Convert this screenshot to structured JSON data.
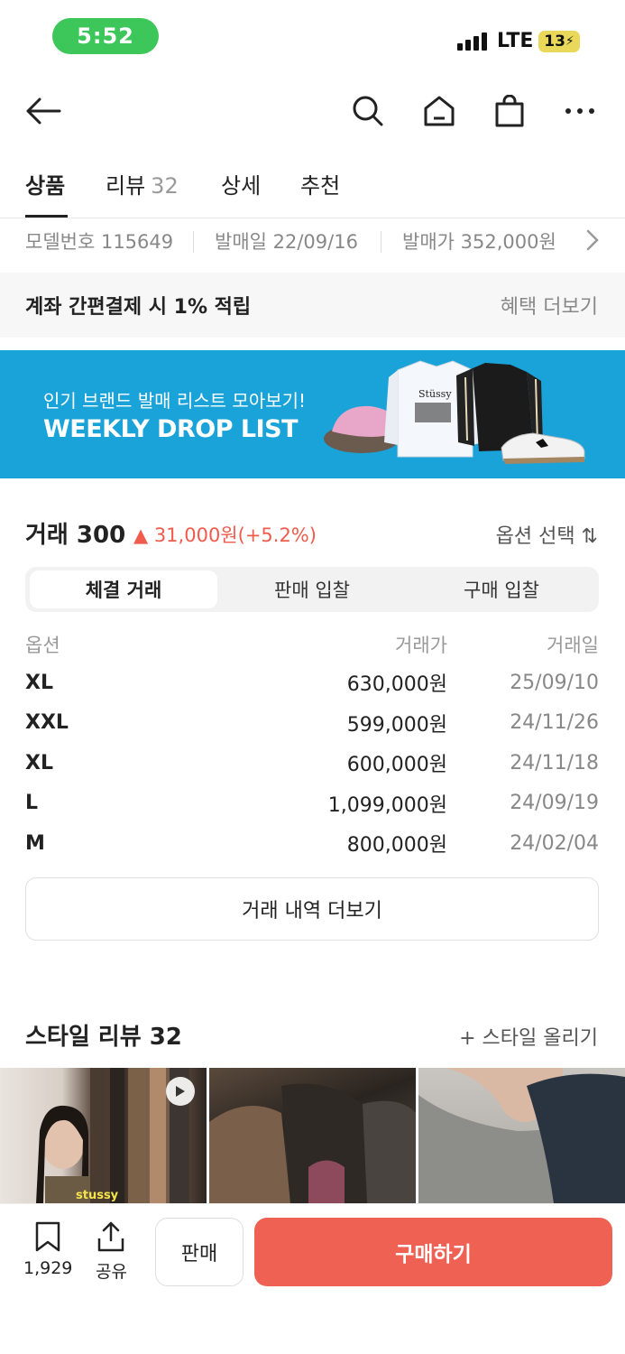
{
  "status": {
    "time": "5:52",
    "network": "LTE",
    "battery": "13"
  },
  "header": {
    "icons": [
      "back-arrow-icon",
      "search-icon",
      "home-icon",
      "shopping-bag-icon",
      "more-icon"
    ]
  },
  "tabs": [
    {
      "label": "상품",
      "count": ""
    },
    {
      "label": "리뷰",
      "count": "32"
    },
    {
      "label": "상세",
      "count": ""
    },
    {
      "label": "추천",
      "count": ""
    }
  ],
  "info": {
    "model": "모델번호 115649",
    "release": "발매일 22/09/16",
    "price": "발매가 352,000원"
  },
  "account": {
    "text": "계좌 간편결제 시 1% 적립",
    "link": "혜택 더보기"
  },
  "promo": {
    "subtitle": "인기 브랜드 발매 리스트 모아보기!",
    "title": "WEEKLY DROP LIST",
    "shirt_text": "Stüssy"
  },
  "trade": {
    "label": "거래 300",
    "change": "▲ 31,000원(+5.2%)",
    "change_color": "#ef5b4c",
    "option_select": "옵션 선택 ⇅",
    "segments": [
      "체결 거래",
      "판매 입찰",
      "구매 입찰"
    ],
    "columns": [
      "옵션",
      "거래가",
      "거래일"
    ],
    "rows": [
      {
        "option": "XL",
        "price": "630,000원",
        "date": "25/09/10"
      },
      {
        "option": "XXL",
        "price": "599,000원",
        "date": "24/11/26"
      },
      {
        "option": "XL",
        "price": "600,000원",
        "date": "24/11/18"
      },
      {
        "option": "L",
        "price": "1,099,000원",
        "date": "24/09/19"
      },
      {
        "option": "M",
        "price": "800,000원",
        "date": "24/02/04"
      }
    ],
    "more": "거래 내역 더보기"
  },
  "style": {
    "label": "스타일 리뷰 32",
    "upload": "+ 스타일 올리기",
    "photo_caption": "stussy"
  },
  "bottom": {
    "bookmark_count": "1,929",
    "share": "공유",
    "sell": "판매",
    "buy": "구매하기",
    "buy_color": "#ef6253"
  }
}
